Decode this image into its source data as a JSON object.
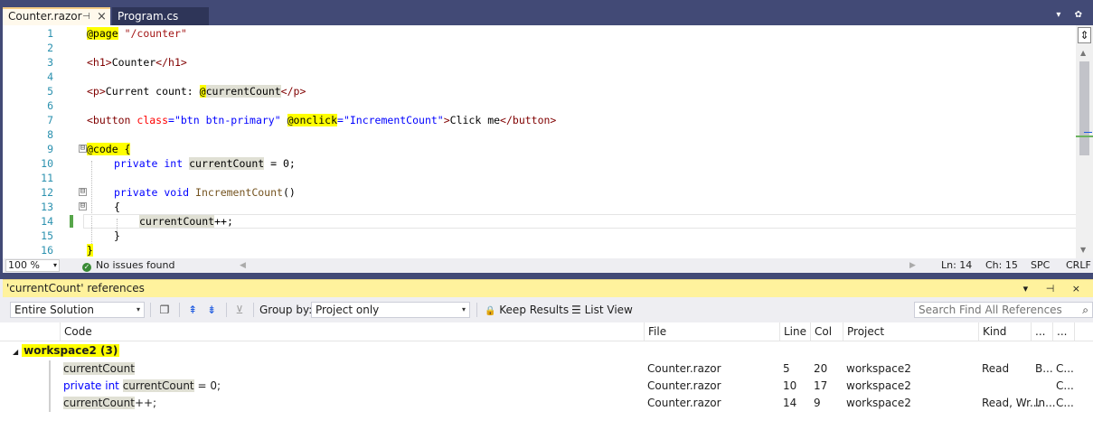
{
  "tabs": [
    {
      "label": "Counter.razor",
      "active": true
    },
    {
      "label": "Program.cs",
      "active": false
    }
  ],
  "tab_controls": {
    "pin": "⊣",
    "close": "×"
  },
  "tabstrip_right": "▾ ✿",
  "editor": {
    "line_numbers": [
      "1",
      "2",
      "3",
      "4",
      "5",
      "6",
      "7",
      "8",
      "9",
      "10",
      "11",
      "12",
      "13",
      "14",
      "15",
      "16"
    ],
    "code": {
      "l1_dir": "@page",
      "l1_str": "\"/counter\"",
      "l3_open": "<h1>",
      "l3_text": "Counter",
      "l3_close": "</h1>",
      "l5_open": "<p>",
      "l5_text": "Current count: ",
      "l5_dir": "@",
      "l5_ref": "currentCount",
      "l5_close": "</p>",
      "l7_open": "<button ",
      "l7_attr1": "class",
      "l7_eq1": "=",
      "l7_val1": "\"btn btn-primary\"",
      "l7_attr2_dir": "@",
      "l7_attr2": "onclick",
      "l7_eq2": "=",
      "l7_val2": "\"IncrementCount\"",
      "l7_close1": ">",
      "l7_text": "Click me",
      "l7_close2": "</button>",
      "l7_close3": ">",
      "l9_dir": "@code",
      "l9_brace": " {",
      "l10_kw": "private int ",
      "l10_ref": "currentCount",
      "l10_rest": " = 0;",
      "l12_kw": "private void ",
      "l12_id": "IncrementCount",
      "l12_rest": "()",
      "l13": "{",
      "l14_ref": "currentCount",
      "l14_rest": "++;",
      "l15": "}",
      "l16": "}"
    },
    "fold_glyph": "⊟",
    "split_glyph": "⇕",
    "scroll_up": "▲",
    "scroll_down": "▼"
  },
  "status": {
    "zoom": "100 %",
    "issues": "No issues found",
    "issues_icon": "✓",
    "ln": "Ln: 14",
    "ch": "Ch: 15",
    "spc": "SPC",
    "crlf": "CRLF",
    "hscroll_left": "◀",
    "hscroll_right": "▶",
    "dropdown": "▾"
  },
  "references": {
    "title": "'currentCount' references",
    "title_controls": "▾ ⊣ ×",
    "toolbar": {
      "scope": "Entire Solution",
      "group_by_label": "Group by:",
      "group_by_value": "Project only",
      "keep_results": "Keep Results",
      "list_view": "List View",
      "search_placeholder": "Search Find All References",
      "copy_icon": "❐",
      "prev_icon": "⇞",
      "next_icon": "⇟",
      "filter_icon": "⊻",
      "lock_icon": "🔒",
      "list_icon": "☰",
      "search_icon": "⌕",
      "dropdown": "▾"
    },
    "columns": [
      "Code",
      "File",
      "Line",
      "Col",
      "Project",
      "Kind",
      "...",
      "..."
    ],
    "group": {
      "arrow": "◢",
      "label": "workspace2  (3)"
    },
    "rows": [
      {
        "code_pre": "",
        "code_ref": "currentCount",
        "code_post": "",
        "file": "Counter.razor",
        "line": "5",
        "col": "20",
        "project": "workspace2",
        "kind": "Read",
        "c7": "B...",
        "c8": "C..."
      },
      {
        "code_pre": "private int ",
        "code_ref": "currentCount",
        "code_post": " = 0;",
        "file": "Counter.razor",
        "line": "10",
        "col": "17",
        "project": "workspace2",
        "kind": "",
        "c7": "",
        "c8": "C..."
      },
      {
        "code_pre": "",
        "code_ref": "currentCount",
        "code_post": "++;",
        "file": "Counter.razor",
        "line": "14",
        "col": "9",
        "project": "workspace2",
        "kind": "Read, Wr...",
        "c7": "In...",
        "c8": "C..."
      }
    ]
  },
  "colors": {
    "chrome": "#424a76",
    "active_tab": "#fff9ec",
    "tool_header": "#fff29d",
    "highlight": "#ffff00",
    "reference": "#e0e0d4"
  }
}
